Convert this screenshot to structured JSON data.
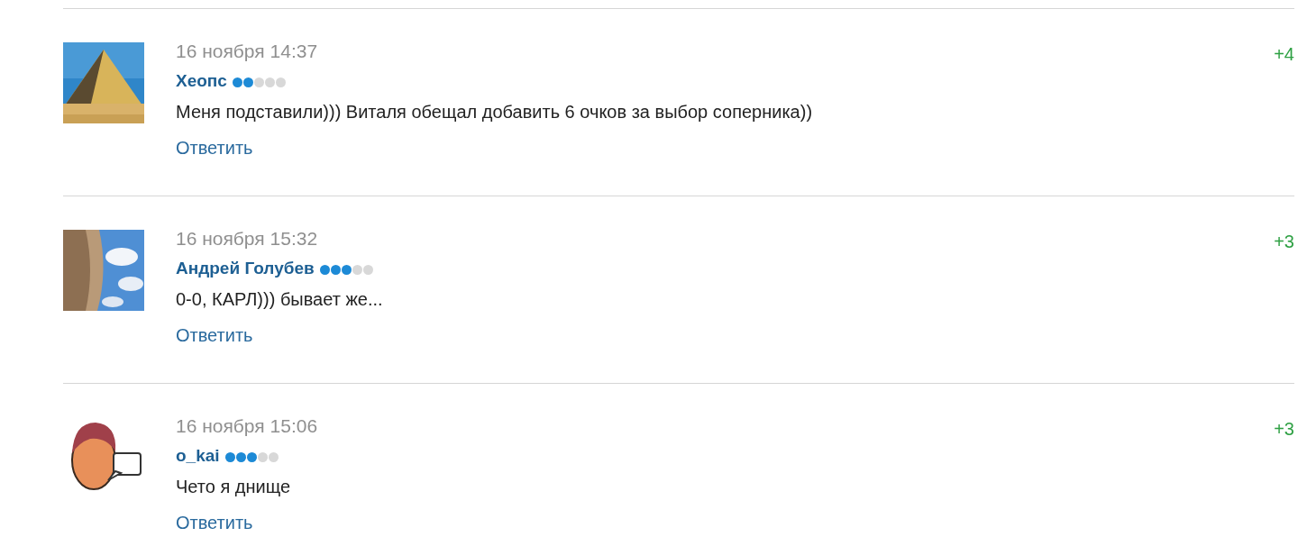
{
  "comments": [
    {
      "date": "16 ноября 14:37",
      "author": "Хеопс",
      "stars": 2,
      "text": "Меня подставили))) Виталя обещал добавить 6 очков за выбор соперника))",
      "reply": "Ответить",
      "score": "+4"
    },
    {
      "date": "16 ноября 15:32",
      "author": "Андрей Голубев",
      "stars": 3,
      "text": "0-0, КАРЛ))) бывает же...",
      "reply": "Ответить",
      "score": "+3"
    },
    {
      "date": "16 ноября 15:06",
      "author": "o_kai",
      "stars": 3,
      "text": "Чето я днище",
      "reply": "Ответить",
      "score": "+3"
    }
  ]
}
